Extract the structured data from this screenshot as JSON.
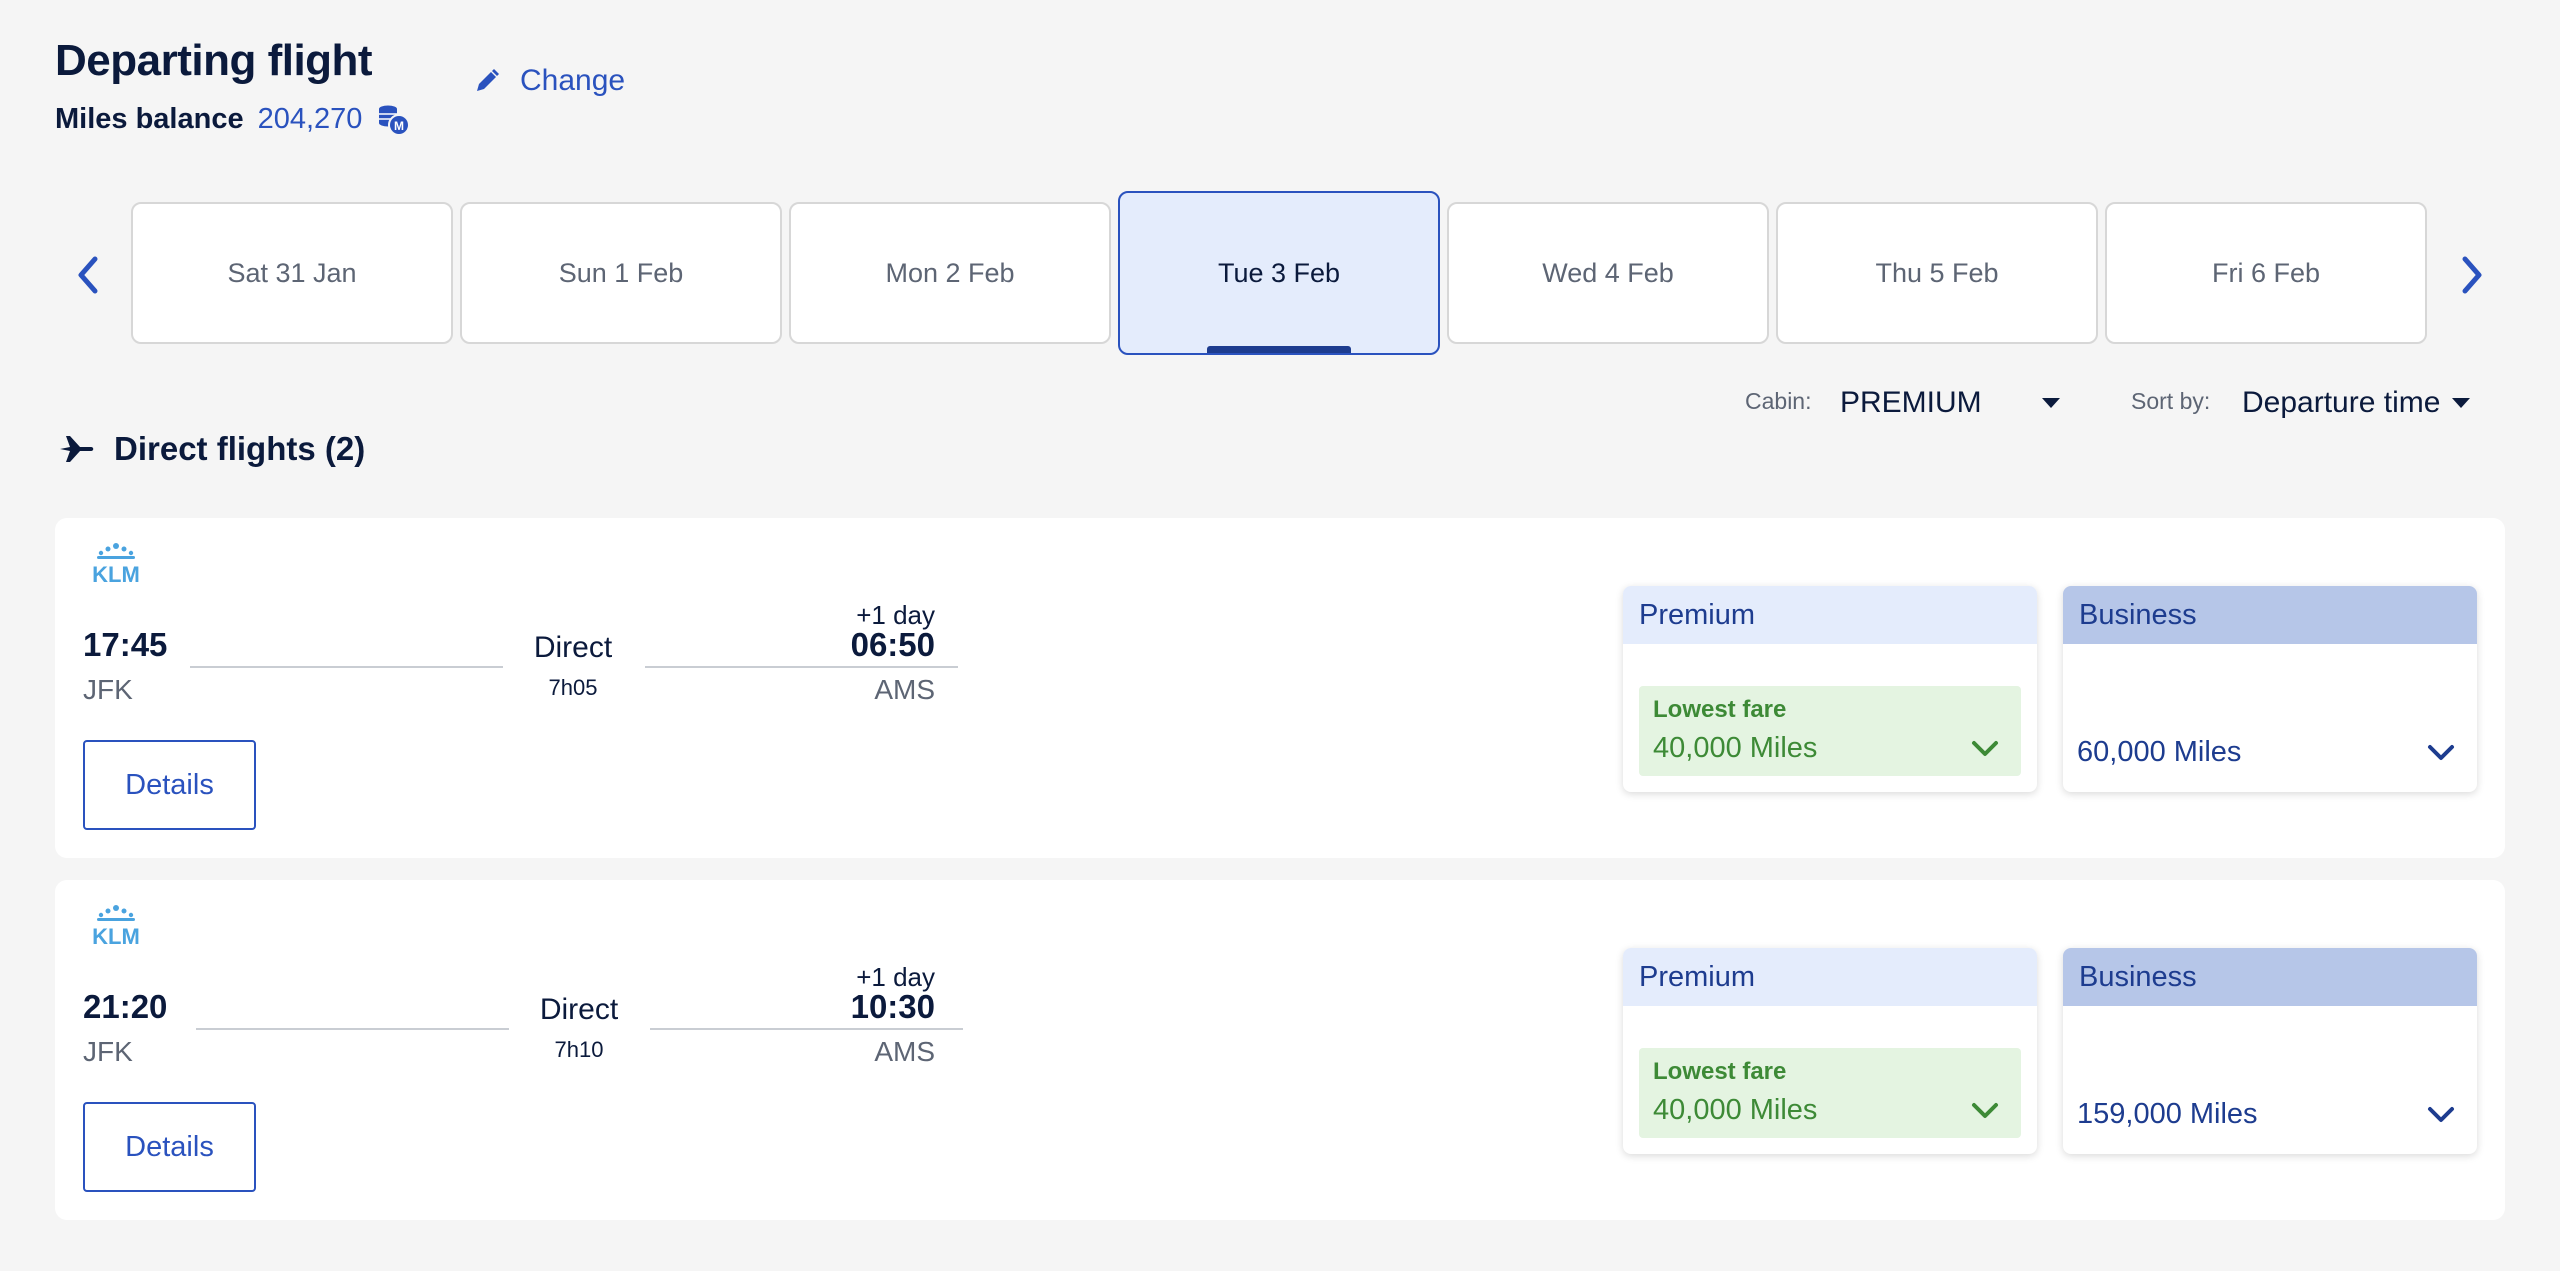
{
  "header": {
    "title": "Departing flight",
    "miles_label": "Miles balance",
    "miles_value": "204,270",
    "change_label": "Change"
  },
  "dates": [
    {
      "label": "Sat 31 Jan",
      "active": false
    },
    {
      "label": "Sun 1 Feb",
      "active": false
    },
    {
      "label": "Mon 2 Feb",
      "active": false
    },
    {
      "label": "Tue 3 Feb",
      "active": true
    },
    {
      "label": "Wed 4 Feb",
      "active": false
    },
    {
      "label": "Thu 5 Feb",
      "active": false
    },
    {
      "label": "Fri 6 Feb",
      "active": false
    }
  ],
  "filters": {
    "cabin_label": "Cabin:",
    "cabin_value": "PREMIUM",
    "sort_label": "Sort by:",
    "sort_value": "Departure time"
  },
  "section": {
    "title": "Direct flights (2)"
  },
  "flights": [
    {
      "airline": "KLM",
      "dep_time": "17:45",
      "dep_code": "JFK",
      "stops": "Direct",
      "duration": "7h05",
      "plus_day": "+1 day",
      "arr_time": "06:50",
      "arr_code": "AMS",
      "details_label": "Details",
      "premium": {
        "title": "Premium",
        "lowest_label": "Lowest fare",
        "miles": "40,000 Miles"
      },
      "business": {
        "title": "Business",
        "miles": "60,000 Miles"
      }
    },
    {
      "airline": "KLM",
      "dep_time": "21:20",
      "dep_code": "JFK",
      "stops": "Direct",
      "duration": "7h10",
      "plus_day": "+1 day",
      "arr_time": "10:30",
      "arr_code": "AMS",
      "details_label": "Details",
      "premium": {
        "title": "Premium",
        "lowest_label": "Lowest fare",
        "miles": "40,000 Miles"
      },
      "business": {
        "title": "Business",
        "miles": "159,000 Miles"
      }
    }
  ],
  "colors": {
    "brand_blue": "#2a52be",
    "dark_navy": "#0b1a3c",
    "lowest_green": "#3d8a36",
    "klm_blue": "#4aa3df"
  },
  "icons": {
    "change": "pencil-icon",
    "miles": "miles-coin-icon",
    "section": "airplane-icon",
    "prev": "chevron-left-icon",
    "next": "chevron-right-icon",
    "expand": "chevron-down-icon"
  }
}
